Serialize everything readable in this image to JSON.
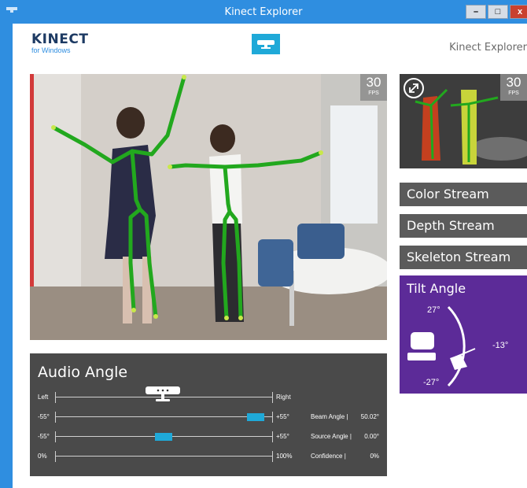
{
  "window": {
    "title": "Kinect Explorer",
    "buttons": {
      "minimize": "–",
      "maximize": "□",
      "close": "x"
    }
  },
  "header": {
    "brand": "KINECT",
    "brand_sub": "for Windows",
    "app_name": "Kinect Explorer"
  },
  "video": {
    "fps_value": "30",
    "fps_label": "FPS"
  },
  "thumbnail": {
    "fps_value": "30",
    "fps_label": "FPS"
  },
  "streams": [
    {
      "label": "Color Stream"
    },
    {
      "label": "Depth Stream"
    },
    {
      "label": "Skeleton Stream"
    }
  ],
  "tilt": {
    "label": "Tilt Angle",
    "max": "27°",
    "current": "-13°",
    "min": "-27°"
  },
  "audio": {
    "heading": "Audio Angle",
    "rows": [
      {
        "left": "Left",
        "right": "Right",
        "caption": "",
        "value": ""
      },
      {
        "left": "-55°",
        "right": "+55°",
        "caption": "Beam Angle |",
        "value": "50.02°"
      },
      {
        "left": "-55°",
        "right": "+55°",
        "caption": "Source Angle |",
        "value": "0.00°"
      },
      {
        "left": "0%",
        "right": "100%",
        "caption": "Confidence |",
        "value": "0%"
      }
    ]
  },
  "colors": {
    "titlebar": "#2f8ee0",
    "accent": "#1fa9d8",
    "tilt_panel": "#5c2b98",
    "button_gray": "#5b5b5b",
    "audio_panel": "#4a4a4a",
    "skeleton": "#22a81e"
  }
}
